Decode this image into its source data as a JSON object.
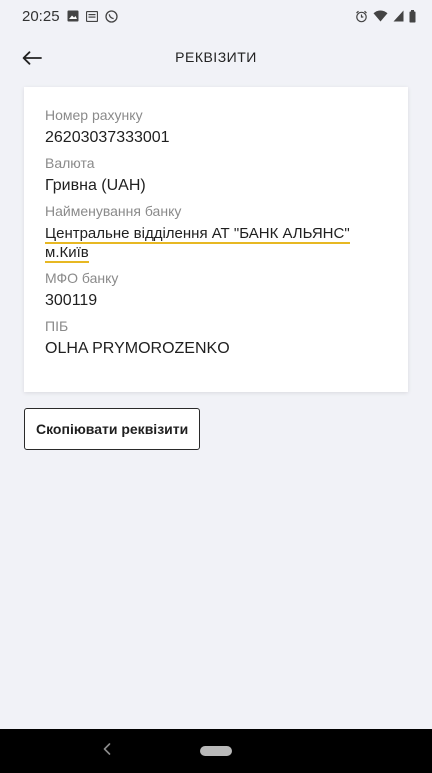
{
  "status_bar": {
    "time": "20:25",
    "left_icons": [
      "image-icon",
      "mail-icon",
      "whatsapp-icon"
    ],
    "right_icons": [
      "alarm-icon",
      "wifi-icon",
      "signal-icon",
      "battery-icon"
    ]
  },
  "header": {
    "title": "РЕКВІЗИТИ",
    "back_icon": "arrow-left-icon"
  },
  "details": {
    "account_label": "Номер рахунку",
    "account_value": "26203037333001",
    "currency_label": "Валюта",
    "currency_value": "Гривна (UAH)",
    "bank_label": "Найменування банку",
    "bank_value": "Центральне відділення АТ \"БАНК АЛЬЯНС\" м.Київ",
    "mfo_label": "МФО банку",
    "mfo_value": "300119",
    "name_label": "ПІБ",
    "name_value": "OLHA PRYMOROZENKO"
  },
  "actions": {
    "copy_label": "Скопіювати реквізити"
  },
  "colors": {
    "background": "#f1f2f7",
    "card": "#ffffff",
    "underline_accent": "#e7b823",
    "nav_bar": "#000000"
  }
}
